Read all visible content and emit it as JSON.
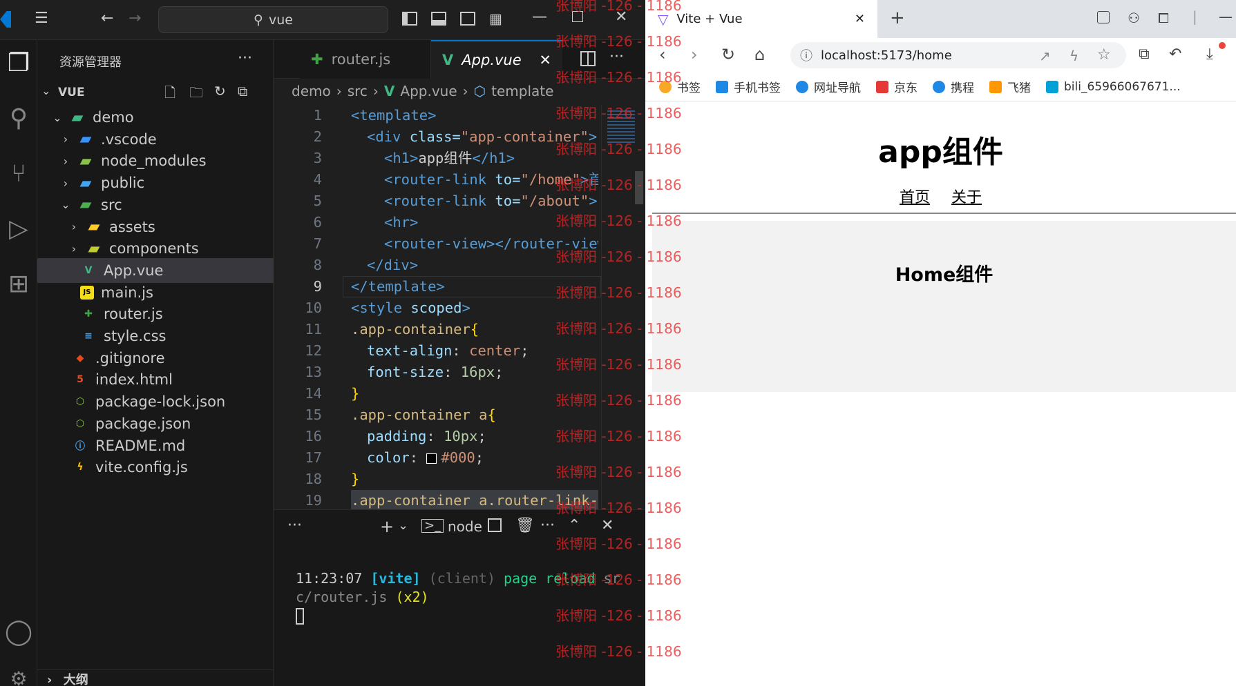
{
  "vscode": {
    "search_text": "vue",
    "explorer_title": "资源管理器",
    "root_folder": "VUE",
    "outline_label": "大纲",
    "tree": [
      {
        "label": "demo",
        "depth": 1,
        "expanded": true,
        "icon": "folder-vue-icon",
        "color": "#41b883"
      },
      {
        "label": ".vscode",
        "depth": 2,
        "expanded": false,
        "icon": "folder-vscode-icon",
        "color": "#3794ff"
      },
      {
        "label": "node_modules",
        "depth": 2,
        "expanded": false,
        "icon": "folder-node-icon",
        "color": "#8bc34a"
      },
      {
        "label": "public",
        "depth": 2,
        "expanded": false,
        "icon": "folder-public-icon",
        "color": "#42a5f5"
      },
      {
        "label": "src",
        "depth": 2,
        "expanded": true,
        "icon": "folder-src-icon",
        "color": "#4caf50"
      },
      {
        "label": "assets",
        "depth": 3,
        "expanded": false,
        "icon": "folder-assets-icon",
        "color": "#ffca28"
      },
      {
        "label": "components",
        "depth": 3,
        "expanded": false,
        "icon": "folder-components-icon",
        "color": "#c0ca33"
      },
      {
        "label": "App.vue",
        "depth": 3,
        "icon": "vue-file-icon",
        "color": "#41b883",
        "selected": true
      },
      {
        "label": "main.js",
        "depth": 3,
        "icon": "js-file-icon",
        "color": "#f5de19"
      },
      {
        "label": "router.js",
        "depth": 3,
        "icon": "router-file-icon",
        "color": "#43a047"
      },
      {
        "label": "style.css",
        "depth": 3,
        "icon": "css-file-icon",
        "color": "#42a5f5"
      },
      {
        "label": ".gitignore",
        "depth": 2,
        "icon": "git-file-icon",
        "color": "#e64a19"
      },
      {
        "label": "index.html",
        "depth": 2,
        "icon": "html-file-icon",
        "color": "#e44d26"
      },
      {
        "label": "package-lock.json",
        "depth": 2,
        "icon": "node-json-icon",
        "color": "#8bc34a"
      },
      {
        "label": "package.json",
        "depth": 2,
        "icon": "node-json-icon",
        "color": "#8bc34a"
      },
      {
        "label": "README.md",
        "depth": 2,
        "icon": "info-file-icon",
        "color": "#42a5f5"
      },
      {
        "label": "vite.config.js",
        "depth": 2,
        "icon": "vite-file-icon",
        "color": "#ffc107"
      }
    ],
    "tabs": [
      {
        "label": "router.js",
        "active": false
      },
      {
        "label": "App.vue",
        "active": true
      }
    ],
    "breadcrumb": [
      "demo",
      "src",
      "App.vue",
      "template"
    ],
    "current_line": "9",
    "code_lines": [
      {
        "n": "1"
      },
      {
        "n": "2"
      },
      {
        "n": "3"
      },
      {
        "n": "4"
      },
      {
        "n": "5"
      },
      {
        "n": "6"
      },
      {
        "n": "7"
      },
      {
        "n": "8"
      },
      {
        "n": "9"
      },
      {
        "n": "10"
      },
      {
        "n": "11"
      },
      {
        "n": "12"
      },
      {
        "n": "13"
      },
      {
        "n": "14"
      },
      {
        "n": "15"
      },
      {
        "n": "16"
      },
      {
        "n": "17"
      },
      {
        "n": "18"
      },
      {
        "n": "19"
      }
    ],
    "code": {
      "l1": "<template>",
      "l2_tag": "<div",
      "l2_attr": " class=",
      "l2_str": "\"app-container\"",
      "l2_end": ">",
      "l3_a": "<h1>",
      "l3_b": "app组件",
      "l3_c": "</h1>",
      "l4_tag": "<router-link",
      "l4_attr": " to=",
      "l4_str": "\"/home\"",
      "l4_end": ">首",
      "l5_tag": "<router-link",
      "l5_attr": " to=",
      "l5_str": "\"/about\"",
      "l5_end": ">",
      "l6": "<hr>",
      "l7": "<router-view></router-view>",
      "l8": "</div>",
      "l9": "</template>",
      "l10_a": "<style",
      "l10_b": " scoped",
      "l10_c": ">",
      "l11_a": ".app-container",
      "l11_b": "{",
      "l12_a": "text-align",
      "l12_b": ": ",
      "l12_c": "center",
      "l12_d": ";",
      "l13_a": "font-size",
      "l13_b": ": ",
      "l13_c": "16px",
      "l13_d": ";",
      "l14": "}",
      "l15_a": ".app-container a",
      "l15_b": "{",
      "l16_a": "padding",
      "l16_b": ": ",
      "l16_c": "10px",
      "l16_d": ";",
      "l17_a": "color",
      "l17_b": ": ",
      "l17_c": "#000",
      "l17_d": ";",
      "l18": "}",
      "l19": ".app-container a.router-link-"
    },
    "terminal": {
      "shell_label": "node",
      "time": "11:23:07",
      "vite": "[vite]",
      "client": "(client)",
      "msg": "page reload",
      "path_a": " sr",
      "path_b": "c/router.js",
      "count": "(x2)"
    }
  },
  "browser": {
    "tab_title": "Vite + Vue",
    "url": "localhost:5173/home",
    "bookmarks": [
      {
        "label": "书签",
        "color": "#f9a825"
      },
      {
        "label": "手机书签",
        "color": "#1e88e5"
      },
      {
        "label": "网址导航",
        "color": "#1e88e5"
      },
      {
        "label": "京东",
        "color": "#e53935"
      },
      {
        "label": "携程",
        "color": "#1e88e5"
      },
      {
        "label": "飞猪",
        "color": "#ff9800"
      },
      {
        "label": "bili_65966067671...",
        "color": "#00a1d6"
      }
    ],
    "app_title": "app组件",
    "nav_links": [
      "首页",
      "关于"
    ],
    "home_title": "Home组件"
  },
  "watermark": {
    "text": "张博阳 -126 - 1186"
  }
}
